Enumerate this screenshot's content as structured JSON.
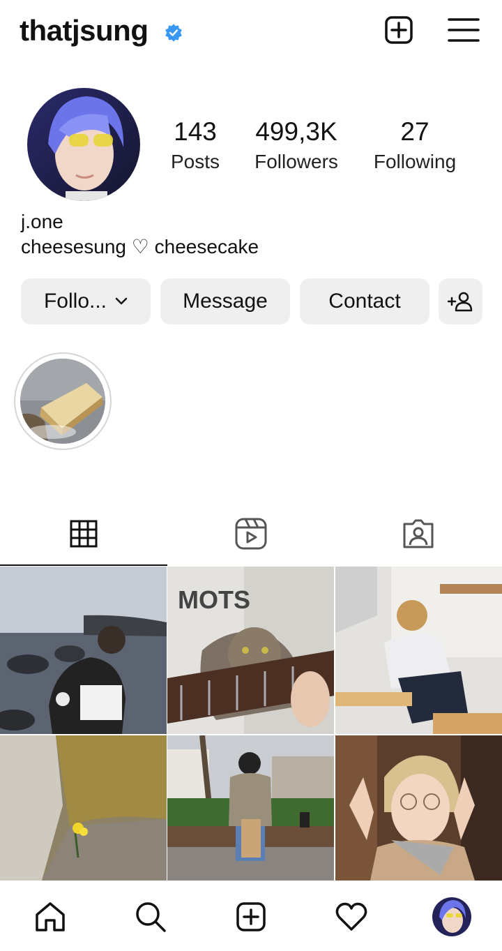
{
  "header": {
    "username": "thatjsung",
    "verified_icon": "verified-badge-icon",
    "verified_color": "#3897f0",
    "add_icon": "plus-square-icon",
    "menu_icon": "hamburger-menu-icon"
  },
  "profile": {
    "stats": {
      "posts_count": "143",
      "posts_label": "Posts",
      "followers_count": "499,3K",
      "followers_label": "Followers",
      "following_count": "27",
      "following_label": "Following"
    },
    "name": "j.one",
    "bio": "cheesesung ♡ cheesecake"
  },
  "actions": {
    "follow_label": "Follo...",
    "message_label": "Message",
    "contact_label": "Contact",
    "add_user_icon": "add-user-icon"
  },
  "highlights": [
    {
      "icon": "cheesecake-highlight-image"
    }
  ],
  "tabs": [
    {
      "icon": "grid-icon",
      "active": true
    },
    {
      "icon": "reels-icon",
      "active": false
    },
    {
      "icon": "tagged-person-icon",
      "active": false
    }
  ],
  "posts": [
    {
      "icon": "post-seaside-photo"
    },
    {
      "icon": "post-cat-guitar-photo"
    },
    {
      "icon": "post-kitchen-photo"
    },
    {
      "icon": "post-flower-rock-photo"
    },
    {
      "icon": "post-bench-street-photo"
    },
    {
      "icon": "post-selfie-photo"
    }
  ],
  "bottom_nav": [
    {
      "icon": "home-icon"
    },
    {
      "icon": "search-icon"
    },
    {
      "icon": "plus-square-icon"
    },
    {
      "icon": "heart-icon"
    },
    {
      "icon": "profile-avatar-icon"
    }
  ],
  "colors": {
    "button_bg": "#efefef",
    "text": "#111111",
    "accent": "#3897f0"
  }
}
